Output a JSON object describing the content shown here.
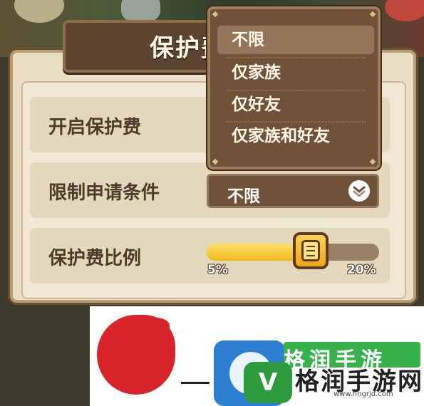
{
  "dialog": {
    "title": "保护费",
    "rows": [
      {
        "label": "开启保护费"
      },
      {
        "label": "限制申请条件"
      },
      {
        "label": "保护费比例"
      }
    ]
  },
  "condition_select": {
    "value": "不限",
    "options": [
      "不限",
      "仅家族",
      "仅好友",
      "仅家族和好友"
    ],
    "selected_index": 0
  },
  "ratio_slider": {
    "min_label": "5%",
    "max_label": "20%",
    "value_fraction": 0.58
  },
  "watermark": {
    "green_text": "格润手游",
    "main_text": "格润手游网",
    "url": "www.hngrjd.com",
    "logo_glyph": "V"
  },
  "colors": {
    "panel": "#eadfc4",
    "dropdown": "#6f5238",
    "slider_fill": "#f2b81c",
    "watermark_red": "#d8252b",
    "watermark_green": "#37b24a"
  },
  "icons": {
    "select_chevron": "chevron-down-icon",
    "slider_handle": "menu-lines-icon"
  }
}
